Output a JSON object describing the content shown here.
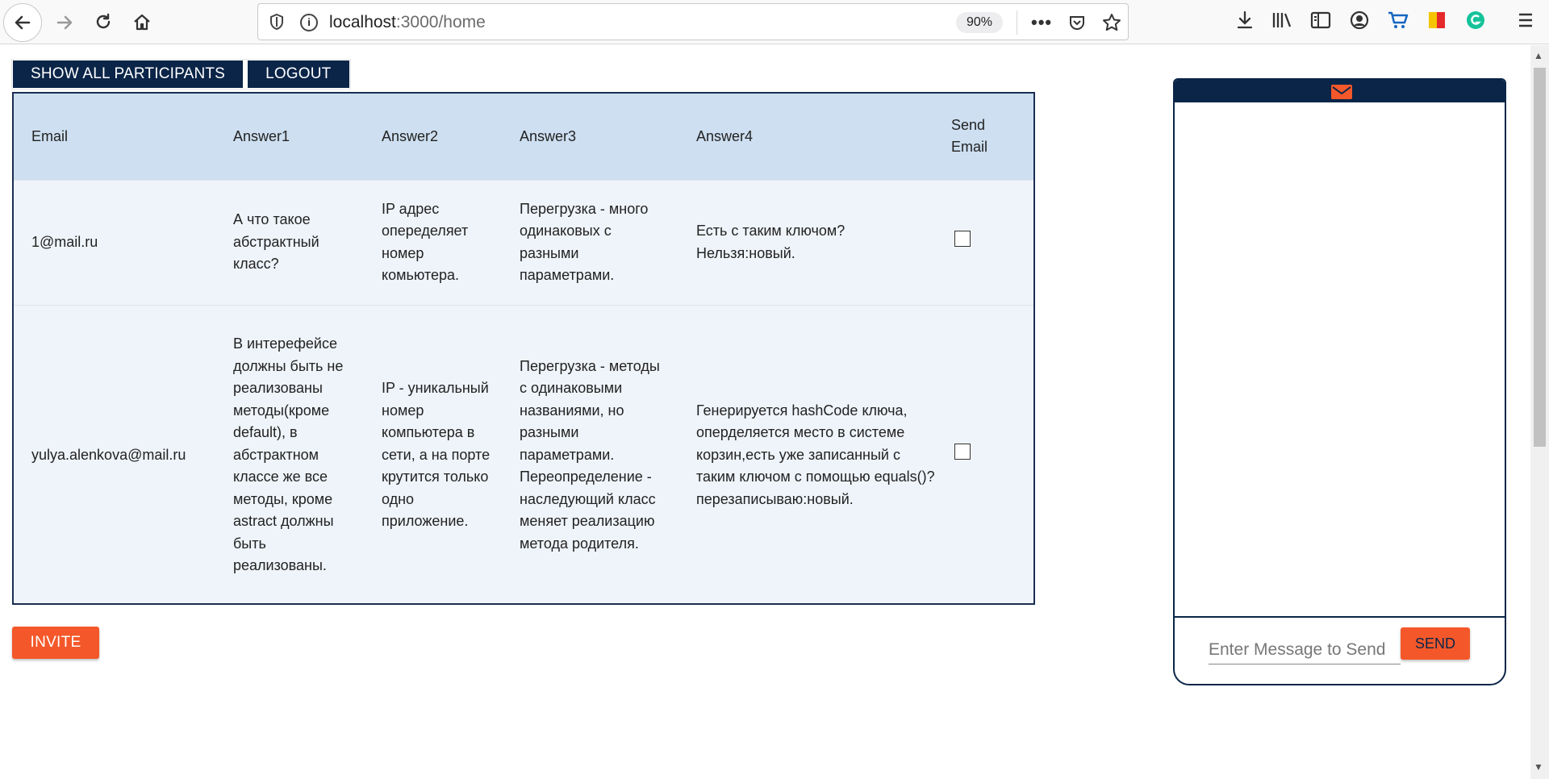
{
  "browser": {
    "url_host": "localhost",
    "url_path": ":3000/home",
    "zoom": "90%"
  },
  "toolbar": {
    "show_all_label": "SHOW ALL PARTICIPANTS",
    "logout_label": "LOGOUT"
  },
  "table": {
    "headers": {
      "email": "Email",
      "answer1": "Answer1",
      "answer2": "Answer2",
      "answer3": "Answer3",
      "answer4": "Answer4",
      "send_email": "Send Email"
    },
    "rows": [
      {
        "email": "1@mail.ru",
        "answer1": "А что такое абстрактный класс?",
        "answer2": "IP адрес опеределяет номер комьютера.",
        "answer3": "Перегрузка - много одинаковых с разными параметрами.",
        "answer4": "Есть с таким ключом?Нельзя:новый.",
        "send": false
      },
      {
        "email": "yulya.alenkova@mail.ru",
        "answer1": "В интерефейсе должны быть не реализованы методы(кроме default), в абстрактном классе же все методы, кроме astract должны быть реализованы.",
        "answer2": "IP - уникальный номер компьютера в сети, а на порте крутится только одно приложение.",
        "answer3": "Перегрузка - методы с одинаковыми названиями, но разными параметрами. Переопределение - наследующий класс меняет реализацию метода родителя.",
        "answer4": "Генерируется hashCode ключа, оперделяется место в системе корзин,есть уже записанный с таким ключом с помощью equals()?перезаписываю:новый.",
        "send": false
      }
    ]
  },
  "invite_label": "INVITE",
  "chat": {
    "input_placeholder": "Enter Message to Send",
    "send_label": "SEND"
  },
  "colors": {
    "navy": "#0b2548",
    "accent": "#f4582a",
    "table_header": "#cddff0",
    "table_row": "#eff4fa"
  }
}
